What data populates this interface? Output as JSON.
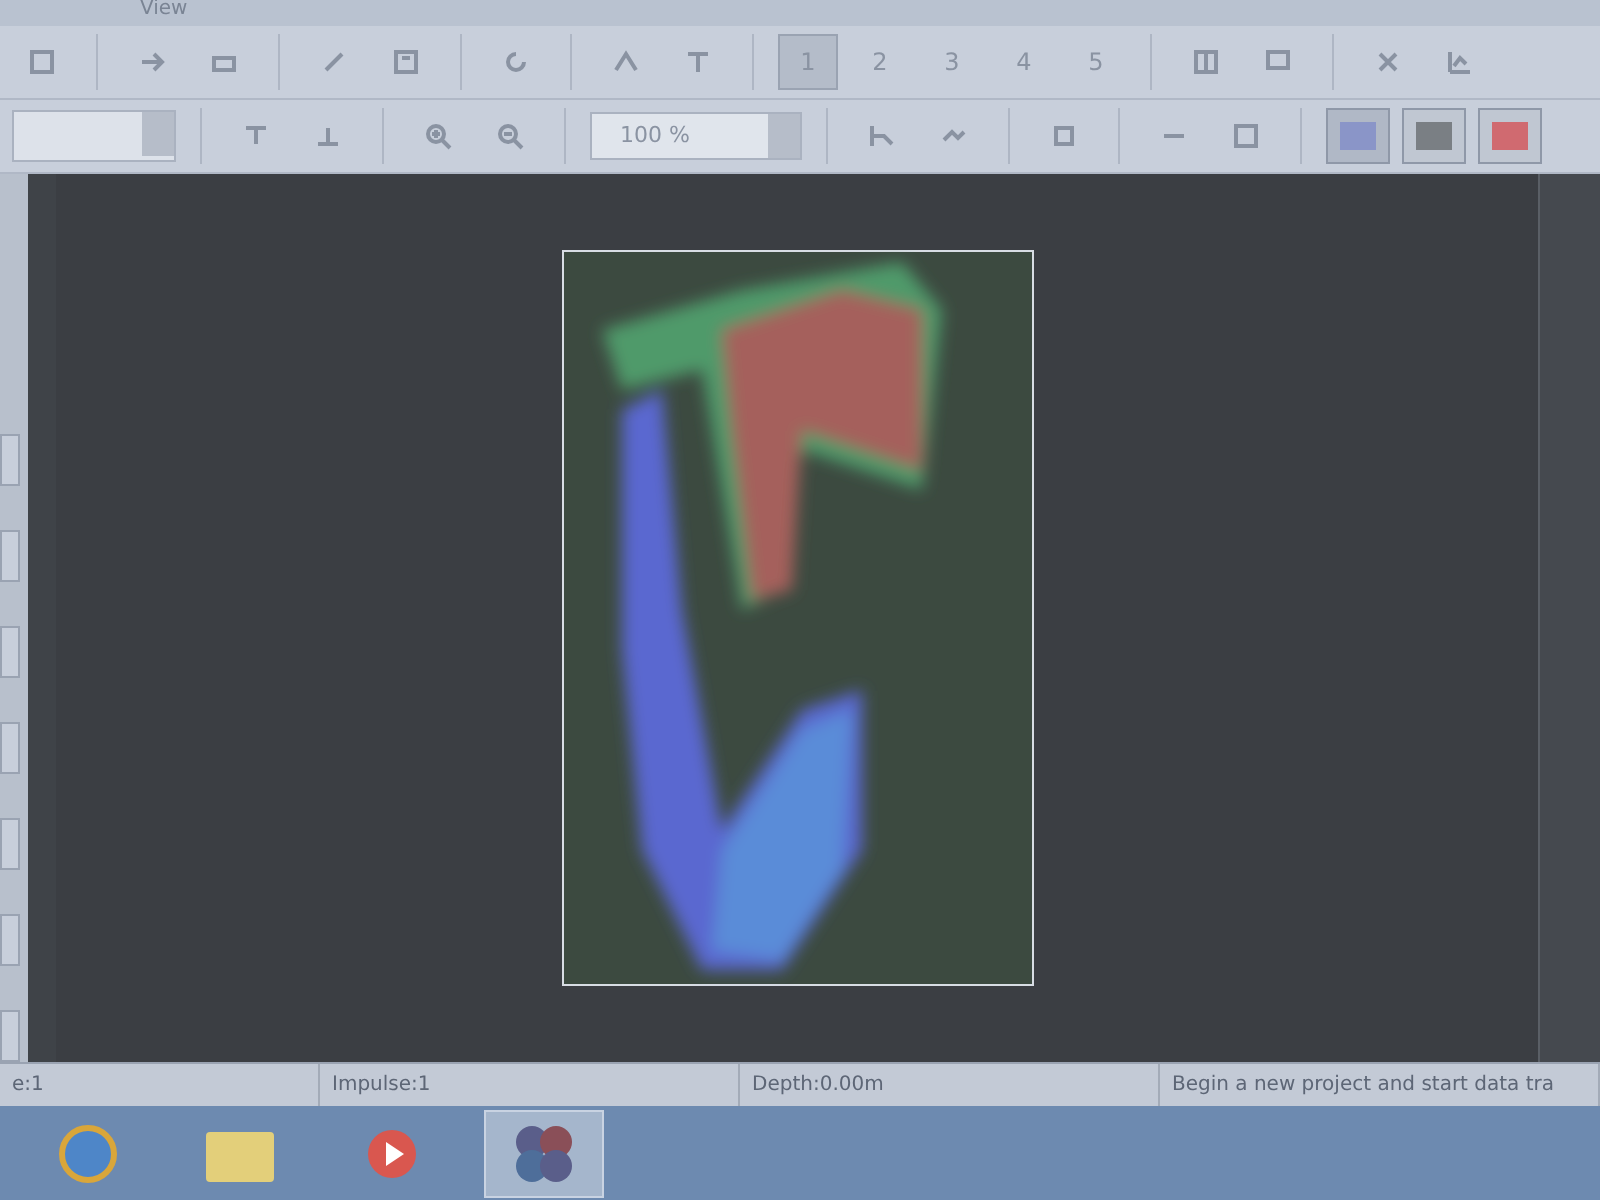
{
  "menu": [
    {
      "label": "View"
    }
  ],
  "toolbar_pages": [
    {
      "label": "1",
      "selected": true
    },
    {
      "label": "2",
      "selected": false
    },
    {
      "label": "3",
      "selected": false
    },
    {
      "label": "4",
      "selected": false
    },
    {
      "label": "5",
      "selected": false
    }
  ],
  "zoom_field": {
    "value": "100 %"
  },
  "color_buttons": [
    {
      "color": "#8a95c8",
      "selected": true
    },
    {
      "color": "#7a7f84",
      "selected": false
    },
    {
      "color": "#d06a70",
      "selected": false
    }
  ],
  "status_bar": [
    {
      "text": "e:1"
    },
    {
      "text": "Impulse:1"
    },
    {
      "text": "Depth:0.00m"
    },
    {
      "text": "Begin a new project and start data tra"
    }
  ],
  "taskbar": [
    {
      "kind": "browser",
      "active": false
    },
    {
      "kind": "folder",
      "active": false
    },
    {
      "kind": "player",
      "active": false
    },
    {
      "kind": "app",
      "active": true
    }
  ]
}
